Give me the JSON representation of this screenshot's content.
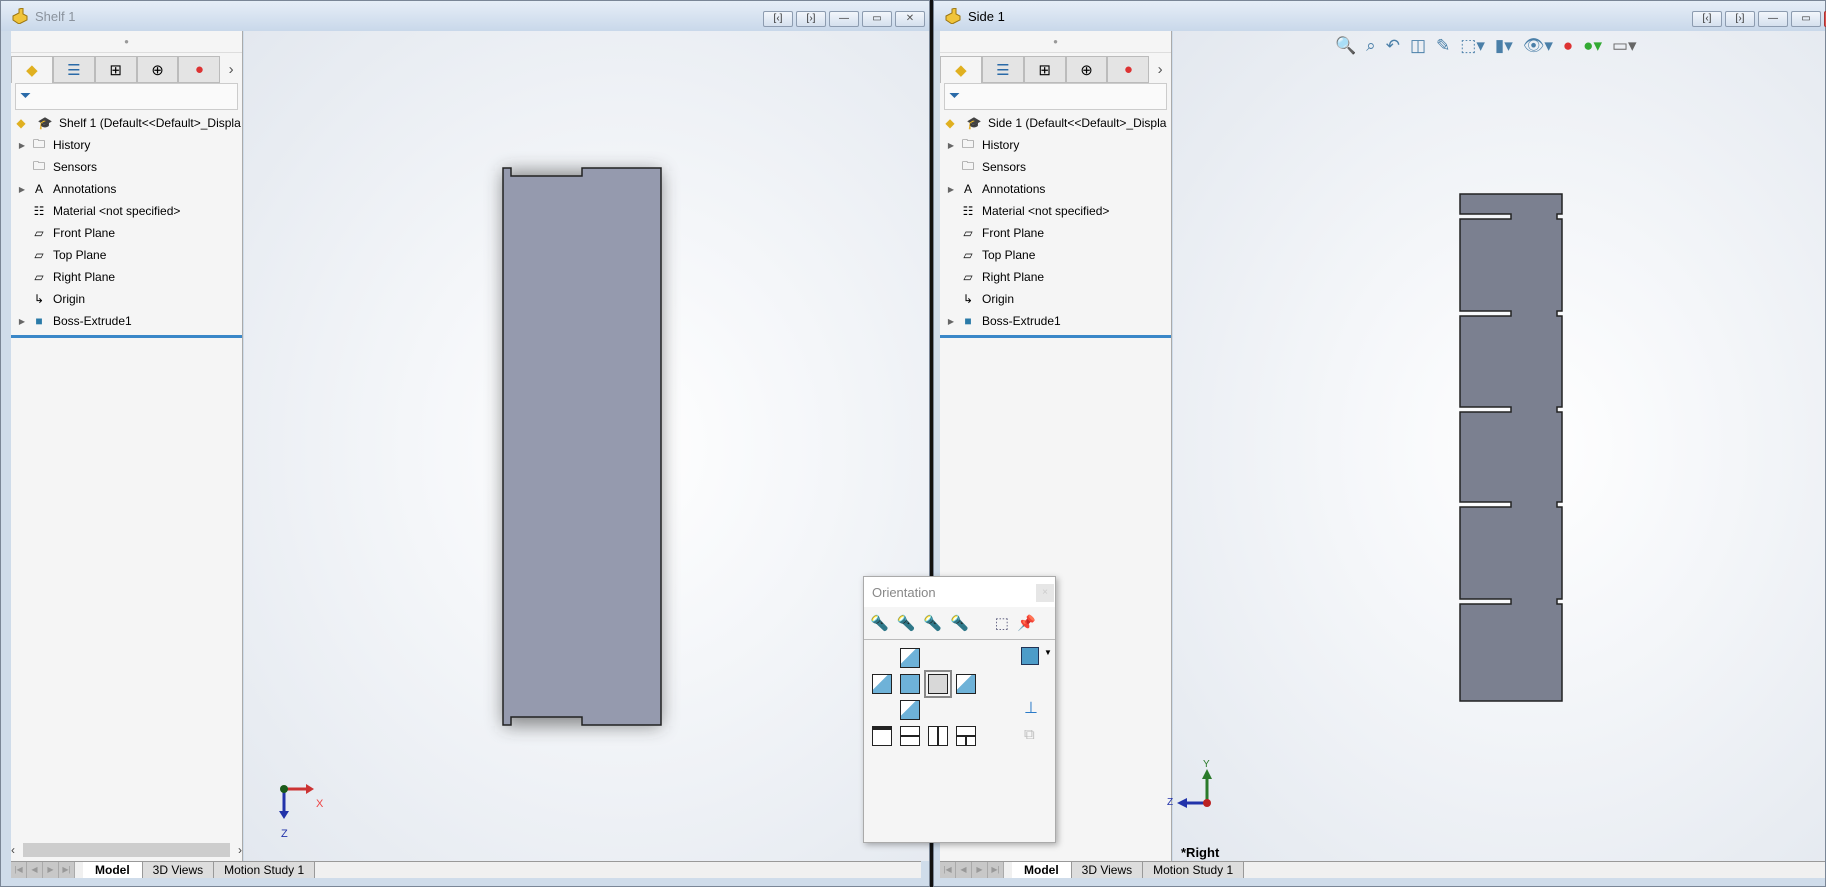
{
  "left_window": {
    "title": "Shelf 1",
    "window_buttons": [
      "tile-left",
      "tile-right",
      "minimize",
      "restore",
      "close"
    ],
    "feature_tabs": [
      "feature-manager",
      "property-manager",
      "configuration-manager",
      "dimxpert-manager",
      "display-manager"
    ],
    "tree_root": "Shelf 1  (Default<<Default>_Displa",
    "tree": [
      "History",
      "Sensors",
      "Annotations",
      "Material <not specified>",
      "Front Plane",
      "Top Plane",
      "Right Plane",
      "Origin",
      "Boss-Extrude1"
    ],
    "bottom_tabs": [
      "Model",
      "3D Views",
      "Motion Study 1"
    ],
    "triad": {
      "x": "X",
      "z": "Z"
    }
  },
  "right_window": {
    "title": "Side 1",
    "tree_root": "Side 1  (Default<<Default>_Displa",
    "tree": [
      "History",
      "Sensors",
      "Annotations",
      "Material <not specified>",
      "Front Plane",
      "Top Plane",
      "Right Plane",
      "Origin",
      "Boss-Extrude1"
    ],
    "bottom_tabs": [
      "Model",
      "3D Views",
      "Motion Study 1"
    ],
    "view_label": "*Right",
    "triad": {
      "y": "Y",
      "z": "Z"
    }
  },
  "orientation_dialog": {
    "title": "Orientation",
    "close": "×"
  },
  "colors": {
    "model_fill_shelf": "#959aae",
    "model_fill_side": "#7b8090",
    "tree_separator": "#3a87c8"
  }
}
